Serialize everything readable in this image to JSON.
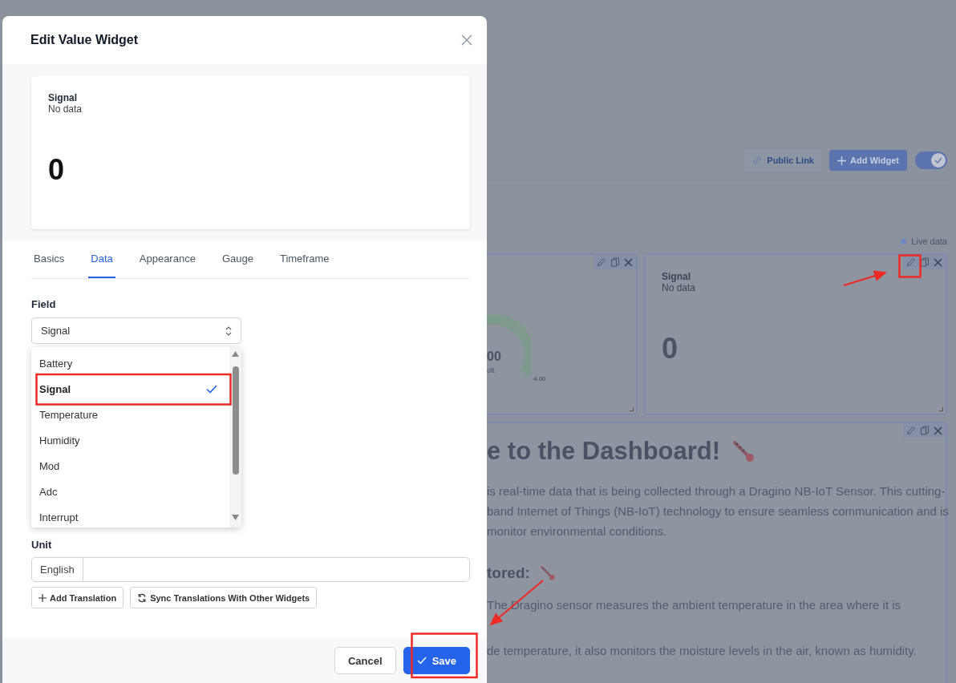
{
  "dialog": {
    "title": "Edit Value Widget",
    "preview": {
      "title": "Signal",
      "subtitle": "No data",
      "value": "0"
    },
    "tabs": [
      {
        "label": "Basics",
        "selected": false
      },
      {
        "label": "Data",
        "selected": true
      },
      {
        "label": "Appearance",
        "selected": false
      },
      {
        "label": "Gauge",
        "selected": false
      },
      {
        "label": "Timeframe",
        "selected": false
      }
    ],
    "field": {
      "label": "Field",
      "value": "Signal",
      "options": [
        {
          "label": "Battery",
          "selected": false
        },
        {
          "label": "Signal",
          "selected": true
        },
        {
          "label": "Temperature",
          "selected": false
        },
        {
          "label": "Humidity",
          "selected": false
        },
        {
          "label": "Mod",
          "selected": false
        },
        {
          "label": "Adc",
          "selected": false
        },
        {
          "label": "Interrupt",
          "selected": false
        }
      ]
    },
    "unit": {
      "label": "Unit",
      "language": "English"
    },
    "translation_buttons": [
      {
        "label": "Add Translation",
        "kind": "add"
      },
      {
        "label": "Sync Translations With Other Widgets",
        "kind": "sync"
      }
    ],
    "footer_buttons": [
      {
        "label": "Cancel",
        "kind": "secondary"
      },
      {
        "label": "Save",
        "kind": "primary"
      }
    ]
  },
  "dashboard": {
    "toolbar": [
      {
        "label": "Public Link",
        "kind": "link"
      },
      {
        "label": "Add Widget",
        "kind": "add"
      }
    ],
    "edit_toggle": {
      "on": true
    },
    "live_indicator": "Live data",
    "widgets": [
      {
        "kind": "gauge",
        "value": "00",
        "unit": "olt",
        "max": "4.00"
      },
      {
        "kind": "value",
        "title": "Signal",
        "subtitle": "No data",
        "value": "0"
      },
      {
        "kind": "text",
        "blocks": [
          {
            "kind": "heading",
            "text": "e to the Dashboard!"
          },
          {
            "kind": "line",
            "text": "is real-time data that is being collected through a Dragino NB-IoT Sensor. This cutting-"
          },
          {
            "kind": "line",
            "text": "band Internet of Things (NB-IoT) technology to ensure seamless communication and is"
          },
          {
            "kind": "line",
            "text": "monitor environmental conditions."
          },
          {
            "kind": "subheading",
            "text": "tored:"
          },
          {
            "kind": "line",
            "text": "The Dragino sensor measures the ambient temperature in the area where it is"
          },
          {
            "kind": "gap"
          },
          {
            "kind": "line",
            "text": "de temperature, it also monitors the moisture levels in the air, known as humidity."
          }
        ]
      }
    ]
  }
}
